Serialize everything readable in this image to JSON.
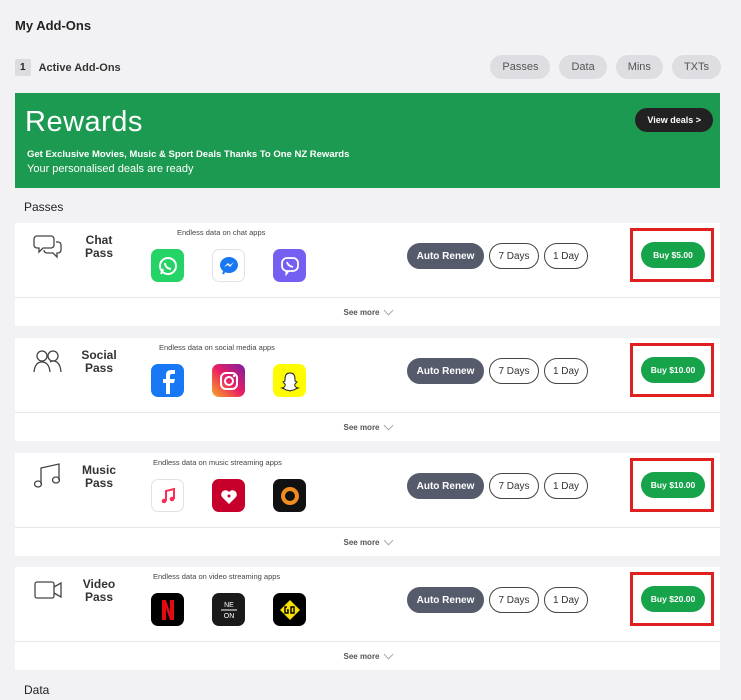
{
  "header": {
    "title": "My Add-Ons",
    "active_count": "1",
    "active_label": "Active Add-Ons"
  },
  "filters": [
    "Passes",
    "Data",
    "Mins",
    "TXTs"
  ],
  "rewards": {
    "title": "Rewards",
    "subtitle": "Get Exclusive Movies, Music & Sport Deals Thanks To One NZ Rewards",
    "subtitle2": "Your personalised deals are ready",
    "cta": "View deals >"
  },
  "sections": {
    "passes": "Passes",
    "data": "Data"
  },
  "option_labels": {
    "auto_renew": "Auto Renew",
    "seven_days": "7 Days",
    "one_day": "1 Day",
    "see_more": "See more"
  },
  "passes": [
    {
      "name_line1": "Chat",
      "name_line2": "Pass",
      "icon": "chat-bubbles-icon",
      "description": "Endless data on chat apps",
      "apps": [
        "whatsapp-icon",
        "messenger-icon",
        "viber-icon"
      ],
      "buy_label": "Buy $5.00"
    },
    {
      "name_line1": "Social",
      "name_line2": "Pass",
      "icon": "people-icon",
      "description": "Endless data on social media apps",
      "apps": [
        "facebook-icon",
        "instagram-icon",
        "snapchat-icon"
      ],
      "buy_label": "Buy $10.00"
    },
    {
      "name_line1": "Music",
      "name_line2": "Pass",
      "icon": "music-note-icon",
      "description": "Endless data on music streaming apps",
      "apps": [
        "apple-music-icon",
        "iheartradio-icon",
        "orange-circle-icon"
      ],
      "buy_label": "Buy $10.00"
    },
    {
      "name_line1": "Video",
      "name_line2": "Pass",
      "icon": "video-camera-icon",
      "description": "Endless data on video streaming apps",
      "apps": [
        "netflix-icon",
        "neon-icon",
        "go-icon"
      ],
      "buy_label": "Buy $20.00"
    }
  ],
  "colors": {
    "rewards_green": "#1d9a51",
    "buy_green": "#16a34a",
    "highlight_red": "#e02020",
    "auto_renew_bg": "#565b6b"
  }
}
